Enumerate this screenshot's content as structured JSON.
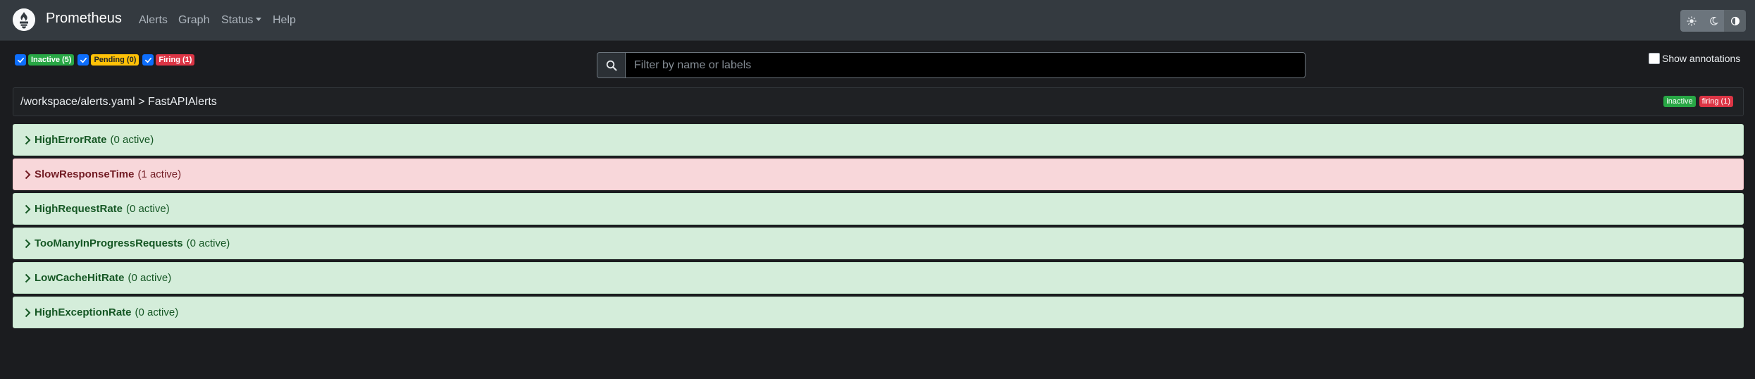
{
  "navbar": {
    "brand": "Prometheus",
    "links": [
      "Alerts",
      "Graph",
      "Status",
      "Help"
    ]
  },
  "filters": {
    "inactive": "Inactive (5)",
    "pending": "Pending (0)",
    "firing": "Firing (1)"
  },
  "search": {
    "placeholder": "Filter by name or labels",
    "value": ""
  },
  "annotations": {
    "label": "Show annotations",
    "checked": false
  },
  "group": {
    "title": "/workspace/alerts.yaml > FastAPIAlerts",
    "badges": [
      "inactive",
      "firing (1)"
    ]
  },
  "rules": [
    {
      "name": "HighErrorRate",
      "count": "(0 active)",
      "state": "inactive"
    },
    {
      "name": "SlowResponseTime",
      "count": "(1 active)",
      "state": "firing"
    },
    {
      "name": "HighRequestRate",
      "count": "(0 active)",
      "state": "inactive"
    },
    {
      "name": "TooManyInProgressRequests",
      "count": "(0 active)",
      "state": "inactive"
    },
    {
      "name": "LowCacheHitRate",
      "count": "(0 active)",
      "state": "inactive"
    },
    {
      "name": "HighExceptionRate",
      "count": "(0 active)",
      "state": "inactive"
    }
  ],
  "colors": {
    "inactive": "#28a745",
    "pending": "#ffc107",
    "firing": "#dc3545",
    "checkbox": "#0d6efd"
  },
  "icons": {
    "logo": "prometheus-flame-icon",
    "search": "search-icon",
    "theme": [
      "sun-icon",
      "moon-icon",
      "contrast-icon"
    ],
    "expand": "chevron-right-icon"
  }
}
